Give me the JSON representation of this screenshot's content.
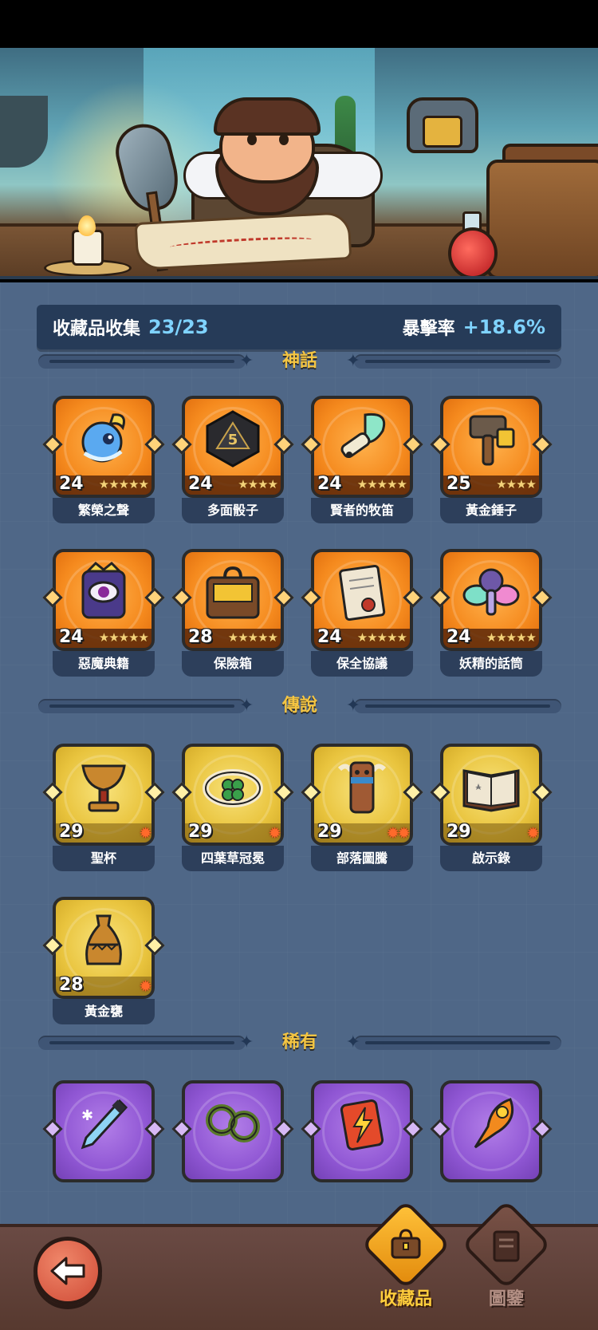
{
  "collection": {
    "label": "收藏品收集",
    "count": "23/23",
    "crit_label": "暴擊率",
    "crit_value": "+18.6%"
  },
  "sections": {
    "mythic": "神話",
    "legendary": "傳說",
    "rare": "稀有"
  },
  "mythic_items": [
    {
      "name": "繁榮之聲",
      "level": "24",
      "stars": "★★★★★",
      "icon": "blue-spirit-icon"
    },
    {
      "name": "多面骰子",
      "level": "24",
      "stars": "★★★★",
      "icon": "d20-dice-icon"
    },
    {
      "name": "賢者的牧笛",
      "level": "24",
      "stars": "★★★★★",
      "icon": "feather-flute-icon"
    },
    {
      "name": "黃金錘子",
      "level": "25",
      "stars": "★★★★",
      "icon": "hammer-icon"
    },
    {
      "name": "惡魔典籍",
      "level": "24",
      "stars": "★★★★★",
      "icon": "demon-eye-book-icon"
    },
    {
      "name": "保險箱",
      "level": "28",
      "stars": "★★★★★",
      "icon": "gold-chest-icon"
    },
    {
      "name": "保全協議",
      "level": "24",
      "stars": "★★★★★",
      "icon": "sealed-scroll-icon"
    },
    {
      "name": "妖精的話筒",
      "level": "24",
      "stars": "★★★★★",
      "icon": "fairy-microphone-icon"
    }
  ],
  "legendary_items": [
    {
      "name": "聖杯",
      "level": "29",
      "shards": "✹",
      "icon": "grail-icon"
    },
    {
      "name": "四葉草冠冕",
      "level": "29",
      "shards": "✹",
      "icon": "clover-crown-icon"
    },
    {
      "name": "部落圖騰",
      "level": "29",
      "shards": "✹✹",
      "icon": "totem-icon"
    },
    {
      "name": "啟示錄",
      "level": "29",
      "shards": "✹",
      "icon": "open-book-icon"
    },
    {
      "name": "黃金甕",
      "level": "28",
      "shards": "✹",
      "icon": "golden-urn-icon"
    }
  ],
  "rare_items": [
    {
      "icon": "ice-dagger-icon"
    },
    {
      "icon": "thorn-vine-icon"
    },
    {
      "icon": "lightning-card-icon"
    },
    {
      "icon": "phoenix-feather-icon"
    }
  ],
  "nav": {
    "collection_label": "收藏品",
    "codex_label": "圖鑒"
  },
  "colors": {
    "mythic": "#f58a1e",
    "legendary": "#e9c43e",
    "rare": "#9057d4",
    "accent_blue": "#7fd3ff",
    "section_title": "#f4c542"
  }
}
